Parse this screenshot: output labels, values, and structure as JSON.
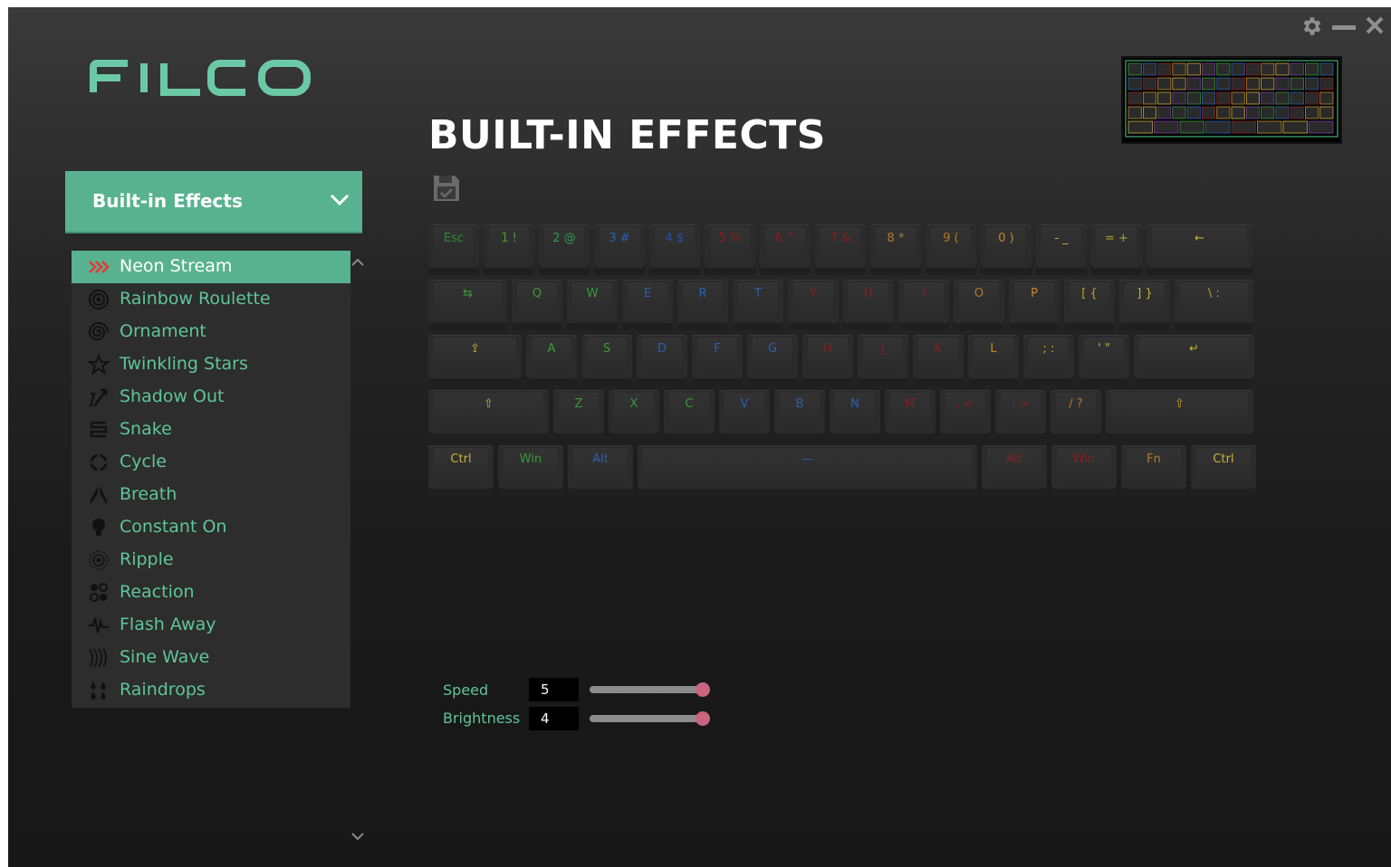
{
  "window": {
    "settings_icon": "gear-icon",
    "minimize_icon": "minus-icon",
    "close_icon": "close-icon"
  },
  "brand": {
    "logo_text": "FILCO",
    "accent": "#59b28f",
    "text_accent": "#5fc49c"
  },
  "page": {
    "title": "BUILT-IN EFFECTS"
  },
  "mode_dropdown": {
    "selected": "Built-in Effects"
  },
  "effects": [
    {
      "label": "Neon Stream",
      "icon": "triple-chevron-icon",
      "selected": true
    },
    {
      "label": "Rainbow Roulette",
      "icon": "roulette-icon"
    },
    {
      "label": "Ornament",
      "icon": "spiral-icon"
    },
    {
      "label": "Twinkling Stars",
      "icon": "star-icon"
    },
    {
      "label": "Shadow Out",
      "icon": "arrow-out-icon"
    },
    {
      "label": "Snake",
      "icon": "snake-icon"
    },
    {
      "label": "Cycle",
      "icon": "cycle-icon"
    },
    {
      "label": "Breath",
      "icon": "lungs-icon"
    },
    {
      "label": "Constant On",
      "icon": "bulb-icon"
    },
    {
      "label": "Ripple",
      "icon": "ripple-icon"
    },
    {
      "label": "Reaction",
      "icon": "reaction-icon"
    },
    {
      "label": "Flash Away",
      "icon": "flash-icon"
    },
    {
      "label": "Sine Wave",
      "icon": "sine-wave-icon"
    },
    {
      "label": "Raindrops",
      "icon": "raindrops-icon"
    }
  ],
  "keyboard": {
    "rows": [
      [
        {
          "label": "Esc",
          "color": "#2e8a3a"
        },
        {
          "label": "1 !",
          "color": "#4a9a2c"
        },
        {
          "label": "2 @",
          "color": "#2f9a4a"
        },
        {
          "label": "3 #",
          "color": "#2a5fb0"
        },
        {
          "label": "4 $",
          "color": "#2a4fa8"
        },
        {
          "label": "5 %",
          "color": "#8a1f1f"
        },
        {
          "label": "6 ^",
          "color": "#8a1f1f"
        },
        {
          "label": "7 &",
          "color": "#8a1f1f"
        },
        {
          "label": "8 *",
          "color": "#b07a2a"
        },
        {
          "label": "9 (",
          "color": "#b07a2a"
        },
        {
          "label": "0 )",
          "color": "#c48a2a"
        },
        {
          "label": "- _",
          "color": "#c8b23a"
        },
        {
          "label": "= +",
          "color": "#a8a02a"
        },
        {
          "label": "←",
          "color": "#c8b23a"
        }
      ],
      [
        {
          "label": "⇆",
          "color": "#3a9a3a"
        },
        {
          "label": "Q",
          "color": "#3a9a3a"
        },
        {
          "label": "W",
          "color": "#3a9a3a"
        },
        {
          "label": "E",
          "color": "#2a5fb0"
        },
        {
          "label": "R",
          "color": "#2a5fb0"
        },
        {
          "label": "T",
          "color": "#2a5fb0"
        },
        {
          "label": "Y",
          "color": "#8a1f1f"
        },
        {
          "label": "U",
          "color": "#8a1f1f"
        },
        {
          "label": "I",
          "color": "#8a1f1f"
        },
        {
          "label": "O",
          "color": "#b07a2a"
        },
        {
          "label": "P",
          "color": "#c48a2a"
        },
        {
          "label": "[ {",
          "color": "#c8a02a"
        },
        {
          "label": "] }",
          "color": "#c8b23a"
        },
        {
          "label": "\\ :",
          "color": "#a8a02a"
        }
      ],
      [
        {
          "label": "⇪",
          "color": "#c8b23a"
        },
        {
          "label": "A",
          "color": "#3a9a3a"
        },
        {
          "label": "S",
          "color": "#3a9a3a"
        },
        {
          "label": "D",
          "color": "#2a5fb0"
        },
        {
          "label": "F",
          "color": "#2a5fb0"
        },
        {
          "label": "G",
          "color": "#2a5fb0"
        },
        {
          "label": "H",
          "color": "#8a1f1f"
        },
        {
          "label": "J",
          "color": "#8a1f1f"
        },
        {
          "label": "K",
          "color": "#8a1f1f"
        },
        {
          "label": "L",
          "color": "#c48a2a"
        },
        {
          "label": "; :",
          "color": "#c8a02a"
        },
        {
          "label": "' \"",
          "color": "#c8b23a"
        },
        {
          "label": "↵",
          "color": "#c8b23a"
        }
      ],
      [
        {
          "label": "⇧",
          "color": "#c8b23a"
        },
        {
          "label": "Z",
          "color": "#3a9a3a"
        },
        {
          "label": "X",
          "color": "#3a9a3a"
        },
        {
          "label": "C",
          "color": "#3a9a3a"
        },
        {
          "label": "V",
          "color": "#2a5fb0"
        },
        {
          "label": "B",
          "color": "#2a5fb0"
        },
        {
          "label": "N",
          "color": "#2a5fb0"
        },
        {
          "label": "M",
          "color": "#8a1f1f"
        },
        {
          "label": ", <",
          "color": "#8a1f1f"
        },
        {
          "label": ". >",
          "color": "#8a1f1f"
        },
        {
          "label": "/ ?",
          "color": "#b07a2a"
        },
        {
          "label": "⇧",
          "color": "#c8a02a"
        }
      ],
      [
        {
          "label": "Ctrl",
          "color": "#c8b23a"
        },
        {
          "label": "Win",
          "color": "#3a9a3a"
        },
        {
          "label": "Alt",
          "color": "#2a5fb0"
        },
        {
          "label": "—",
          "color": "#2a5fb0"
        },
        {
          "label": "Alt",
          "color": "#8a1f1f"
        },
        {
          "label": "Win",
          "color": "#8a1f1f"
        },
        {
          "label": "Fn",
          "color": "#b07a2a"
        },
        {
          "label": "Ctrl",
          "color": "#c8b23a"
        }
      ]
    ]
  },
  "controls": {
    "speed": {
      "label": "Speed",
      "value": "5",
      "fraction": 1.0
    },
    "brightness": {
      "label": "Brightness",
      "value": "4",
      "fraction": 1.0
    }
  }
}
